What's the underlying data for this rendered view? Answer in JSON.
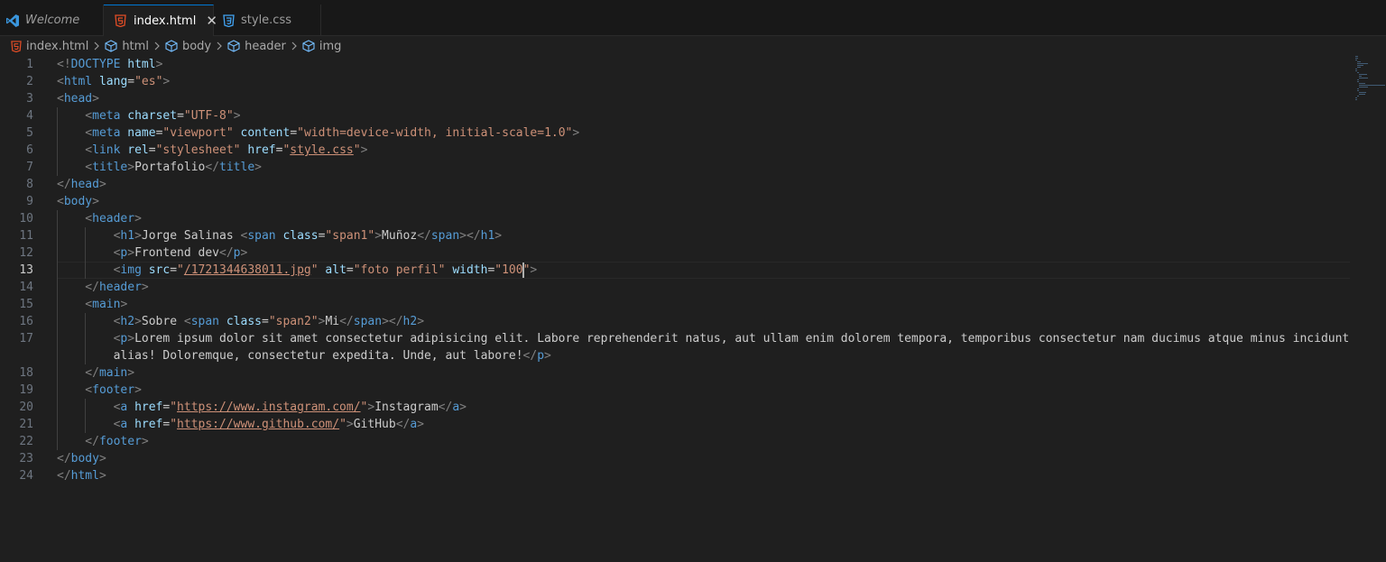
{
  "tabs": [
    {
      "label": "Welcome",
      "icon": "vscode-icon"
    },
    {
      "label": "index.html",
      "icon": "html5-icon",
      "active": true,
      "close": "✕"
    },
    {
      "label": "style.css",
      "icon": "css-icon"
    }
  ],
  "breadcrumb": [
    "index.html",
    "html",
    "body",
    "header",
    "img"
  ],
  "editor": {
    "active_line": 13,
    "colors": {
      "tag": "#569cd6",
      "attribute": "#9cdcfe",
      "string": "#ce9178",
      "punctuation": "#808080",
      "text": "#cccccc",
      "accent": "#0078d4",
      "html_icon": "#e44d26",
      "css_icon": "#42a5f5"
    },
    "lines": [
      {
        "num": "1",
        "tokens": [
          {
            "t": "punct",
            "v": "<!"
          },
          {
            "t": "tag",
            "v": "DOCTYPE"
          },
          {
            "t": "text",
            "v": " "
          },
          {
            "t": "attr",
            "v": "html"
          },
          {
            "t": "punct",
            "v": ">"
          }
        ]
      },
      {
        "num": "2",
        "tokens": [
          {
            "t": "punct",
            "v": "<"
          },
          {
            "t": "tag",
            "v": "html"
          },
          {
            "t": "text",
            "v": " "
          },
          {
            "t": "attr",
            "v": "lang"
          },
          {
            "t": "text",
            "v": "="
          },
          {
            "t": "str",
            "v": "\"es\""
          },
          {
            "t": "punct",
            "v": ">"
          }
        ]
      },
      {
        "num": "3",
        "tokens": [
          {
            "t": "punct",
            "v": "<"
          },
          {
            "t": "tag",
            "v": "head"
          },
          {
            "t": "punct",
            "v": ">"
          }
        ]
      },
      {
        "num": "4",
        "indent": 1,
        "tokens": [
          {
            "t": "punct",
            "v": "<"
          },
          {
            "t": "tag",
            "v": "meta"
          },
          {
            "t": "text",
            "v": " "
          },
          {
            "t": "attr",
            "v": "charset"
          },
          {
            "t": "text",
            "v": "="
          },
          {
            "t": "str",
            "v": "\"UTF-8\""
          },
          {
            "t": "punct",
            "v": ">"
          }
        ]
      },
      {
        "num": "5",
        "indent": 1,
        "tokens": [
          {
            "t": "punct",
            "v": "<"
          },
          {
            "t": "tag",
            "v": "meta"
          },
          {
            "t": "text",
            "v": " "
          },
          {
            "t": "attr",
            "v": "name"
          },
          {
            "t": "text",
            "v": "="
          },
          {
            "t": "str",
            "v": "\"viewport\""
          },
          {
            "t": "text",
            "v": " "
          },
          {
            "t": "attr",
            "v": "content"
          },
          {
            "t": "text",
            "v": "="
          },
          {
            "t": "str",
            "v": "\"width=device-width, initial-scale=1.0\""
          },
          {
            "t": "punct",
            "v": ">"
          }
        ]
      },
      {
        "num": "6",
        "indent": 1,
        "tokens": [
          {
            "t": "punct",
            "v": "<"
          },
          {
            "t": "tag",
            "v": "link"
          },
          {
            "t": "text",
            "v": " "
          },
          {
            "t": "attr",
            "v": "rel"
          },
          {
            "t": "text",
            "v": "="
          },
          {
            "t": "str",
            "v": "\"stylesheet\""
          },
          {
            "t": "text",
            "v": " "
          },
          {
            "t": "attr",
            "v": "href"
          },
          {
            "t": "text",
            "v": "="
          },
          {
            "t": "str",
            "v": "\""
          },
          {
            "t": "url",
            "v": "style.css"
          },
          {
            "t": "str",
            "v": "\""
          },
          {
            "t": "punct",
            "v": ">"
          }
        ]
      },
      {
        "num": "7",
        "indent": 1,
        "tokens": [
          {
            "t": "punct",
            "v": "<"
          },
          {
            "t": "tag",
            "v": "title"
          },
          {
            "t": "punct",
            "v": ">"
          },
          {
            "t": "text",
            "v": "Portafolio"
          },
          {
            "t": "punct",
            "v": "</"
          },
          {
            "t": "tag",
            "v": "title"
          },
          {
            "t": "punct",
            "v": ">"
          }
        ]
      },
      {
        "num": "8",
        "tokens": [
          {
            "t": "punct",
            "v": "</"
          },
          {
            "t": "tag",
            "v": "head"
          },
          {
            "t": "punct",
            "v": ">"
          }
        ]
      },
      {
        "num": "9",
        "tokens": [
          {
            "t": "punct",
            "v": "<"
          },
          {
            "t": "tag",
            "v": "body"
          },
          {
            "t": "punct",
            "v": ">"
          }
        ]
      },
      {
        "num": "10",
        "indent": 1,
        "tokens": [
          {
            "t": "punct",
            "v": "<"
          },
          {
            "t": "tag",
            "v": "header"
          },
          {
            "t": "punct",
            "v": ">"
          }
        ]
      },
      {
        "num": "11",
        "indent": 2,
        "tokens": [
          {
            "t": "punct",
            "v": "<"
          },
          {
            "t": "tag",
            "v": "h1"
          },
          {
            "t": "punct",
            "v": ">"
          },
          {
            "t": "text",
            "v": "Jorge Salinas "
          },
          {
            "t": "punct",
            "v": "<"
          },
          {
            "t": "tag",
            "v": "span"
          },
          {
            "t": "text",
            "v": " "
          },
          {
            "t": "attr",
            "v": "class"
          },
          {
            "t": "text",
            "v": "="
          },
          {
            "t": "str",
            "v": "\"span1\""
          },
          {
            "t": "punct",
            "v": ">"
          },
          {
            "t": "text",
            "v": "Muñoz"
          },
          {
            "t": "punct",
            "v": "</"
          },
          {
            "t": "tag",
            "v": "span"
          },
          {
            "t": "punct",
            "v": "></"
          },
          {
            "t": "tag",
            "v": "h1"
          },
          {
            "t": "punct",
            "v": ">"
          }
        ]
      },
      {
        "num": "12",
        "indent": 2,
        "tokens": [
          {
            "t": "punct",
            "v": "<"
          },
          {
            "t": "tag",
            "v": "p"
          },
          {
            "t": "punct",
            "v": ">"
          },
          {
            "t": "text",
            "v": "Frontend dev"
          },
          {
            "t": "punct",
            "v": "</"
          },
          {
            "t": "tag",
            "v": "p"
          },
          {
            "t": "punct",
            "v": ">"
          }
        ]
      },
      {
        "num": "13",
        "indent": 2,
        "tokens": [
          {
            "t": "punct",
            "v": "<"
          },
          {
            "t": "tag",
            "v": "img"
          },
          {
            "t": "text",
            "v": " "
          },
          {
            "t": "attr",
            "v": "src"
          },
          {
            "t": "text",
            "v": "="
          },
          {
            "t": "str",
            "v": "\""
          },
          {
            "t": "url",
            "v": "/1721344638011.jpg"
          },
          {
            "t": "str",
            "v": "\""
          },
          {
            "t": "text",
            "v": " "
          },
          {
            "t": "attr",
            "v": "alt"
          },
          {
            "t": "text",
            "v": "="
          },
          {
            "t": "str",
            "v": "\"foto perfil\""
          },
          {
            "t": "text",
            "v": " "
          },
          {
            "t": "attr",
            "v": "width"
          },
          {
            "t": "text",
            "v": "="
          },
          {
            "t": "str",
            "v": "\"100"
          },
          {
            "t": "cursor",
            "v": ""
          },
          {
            "t": "str",
            "v": "\""
          },
          {
            "t": "punct",
            "v": ">"
          }
        ]
      },
      {
        "num": "14",
        "indent": 1,
        "tokens": [
          {
            "t": "punct",
            "v": "</"
          },
          {
            "t": "tag",
            "v": "header"
          },
          {
            "t": "punct",
            "v": ">"
          }
        ]
      },
      {
        "num": "15",
        "indent": 1,
        "tokens": [
          {
            "t": "punct",
            "v": "<"
          },
          {
            "t": "tag",
            "v": "main"
          },
          {
            "t": "punct",
            "v": ">"
          }
        ]
      },
      {
        "num": "16",
        "indent": 2,
        "tokens": [
          {
            "t": "punct",
            "v": "<"
          },
          {
            "t": "tag",
            "v": "h2"
          },
          {
            "t": "punct",
            "v": ">"
          },
          {
            "t": "text",
            "v": "Sobre "
          },
          {
            "t": "punct",
            "v": "<"
          },
          {
            "t": "tag",
            "v": "span"
          },
          {
            "t": "text",
            "v": " "
          },
          {
            "t": "attr",
            "v": "class"
          },
          {
            "t": "text",
            "v": "="
          },
          {
            "t": "str",
            "v": "\"span2\""
          },
          {
            "t": "punct",
            "v": ">"
          },
          {
            "t": "text",
            "v": "Mi"
          },
          {
            "t": "punct",
            "v": "</"
          },
          {
            "t": "tag",
            "v": "span"
          },
          {
            "t": "punct",
            "v": "></"
          },
          {
            "t": "tag",
            "v": "h2"
          },
          {
            "t": "punct",
            "v": ">"
          }
        ]
      },
      {
        "num": "17",
        "indent": 2,
        "tokens": [
          {
            "t": "punct",
            "v": "<"
          },
          {
            "t": "tag",
            "v": "p"
          },
          {
            "t": "punct",
            "v": ">"
          },
          {
            "t": "text",
            "v": "Lorem ipsum dolor sit amet consectetur adipisicing elit. Labore reprehenderit natus, aut ullam enim dolorem tempora, temporibus consectetur nam ducimus atque minus incidunt"
          }
        ]
      },
      {
        "num": "",
        "indent": 2,
        "tokens": [
          {
            "t": "text",
            "v": "alias! Doloremque, consectetur expedita. Unde, aut labore!"
          },
          {
            "t": "punct",
            "v": "</"
          },
          {
            "t": "tag",
            "v": "p"
          },
          {
            "t": "punct",
            "v": ">"
          }
        ]
      },
      {
        "num": "18",
        "indent": 1,
        "tokens": [
          {
            "t": "punct",
            "v": "</"
          },
          {
            "t": "tag",
            "v": "main"
          },
          {
            "t": "punct",
            "v": ">"
          }
        ]
      },
      {
        "num": "19",
        "indent": 1,
        "tokens": [
          {
            "t": "punct",
            "v": "<"
          },
          {
            "t": "tag",
            "v": "footer"
          },
          {
            "t": "punct",
            "v": ">"
          }
        ]
      },
      {
        "num": "20",
        "indent": 2,
        "tokens": [
          {
            "t": "punct",
            "v": "<"
          },
          {
            "t": "tag",
            "v": "a"
          },
          {
            "t": "text",
            "v": " "
          },
          {
            "t": "attr",
            "v": "href"
          },
          {
            "t": "text",
            "v": "="
          },
          {
            "t": "str",
            "v": "\""
          },
          {
            "t": "url",
            "v": "https://www.instagram.com/"
          },
          {
            "t": "str",
            "v": "\""
          },
          {
            "t": "punct",
            "v": ">"
          },
          {
            "t": "text",
            "v": "Instagram"
          },
          {
            "t": "punct",
            "v": "</"
          },
          {
            "t": "tag",
            "v": "a"
          },
          {
            "t": "punct",
            "v": ">"
          }
        ]
      },
      {
        "num": "21",
        "indent": 2,
        "tokens": [
          {
            "t": "punct",
            "v": "<"
          },
          {
            "t": "tag",
            "v": "a"
          },
          {
            "t": "text",
            "v": " "
          },
          {
            "t": "attr",
            "v": "href"
          },
          {
            "t": "text",
            "v": "="
          },
          {
            "t": "str",
            "v": "\""
          },
          {
            "t": "url",
            "v": "https://www.github.com/"
          },
          {
            "t": "str",
            "v": "\""
          },
          {
            "t": "punct",
            "v": ">"
          },
          {
            "t": "text",
            "v": "GitHub"
          },
          {
            "t": "punct",
            "v": "</"
          },
          {
            "t": "tag",
            "v": "a"
          },
          {
            "t": "punct",
            "v": ">"
          }
        ]
      },
      {
        "num": "22",
        "indent": 1,
        "tokens": [
          {
            "t": "punct",
            "v": "</"
          },
          {
            "t": "tag",
            "v": "footer"
          },
          {
            "t": "punct",
            "v": ">"
          }
        ]
      },
      {
        "num": "23",
        "tokens": [
          {
            "t": "punct",
            "v": "</"
          },
          {
            "t": "tag",
            "v": "body"
          },
          {
            "t": "punct",
            "v": ">"
          }
        ]
      },
      {
        "num": "24",
        "tokens": [
          {
            "t": "punct",
            "v": "</"
          },
          {
            "t": "tag",
            "v": "html"
          },
          {
            "t": "punct",
            "v": ">"
          }
        ]
      }
    ]
  }
}
